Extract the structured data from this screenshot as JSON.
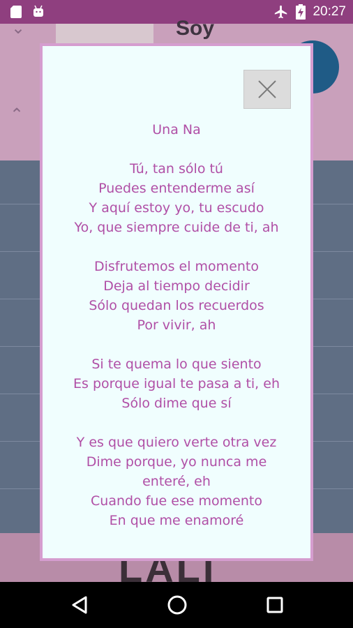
{
  "status_bar": {
    "time": "20:27",
    "icons": [
      "sd-card-icon",
      "android-icon",
      "airplane-icon",
      "battery-charging-icon"
    ]
  },
  "background_app": {
    "title_partial": "Soy",
    "footer_partial": "LALI"
  },
  "dialog": {
    "close_icon": "close-icon",
    "title": "Una Na",
    "lines": [
      "",
      "Tú, tan sólo tú",
      "Puedes entenderme así",
      "Y aquí estoy yo, tu escudo",
      "Yo, que siempre cuide de ti, ah",
      "",
      "Disfrutemos el momento",
      "Deja al tiempo decidir",
      "Sólo quedan los recuerdos",
      "Por vivir, ah",
      "",
      "Si te quema lo que siento",
      "Es porque igual te pasa a ti, eh",
      "Sólo dime que sí",
      "",
      "Y es que quiero verte otra vez",
      "Dime porque, yo nunca me",
      "enteré, eh",
      "Cuando fue ese momento",
      "En que me enamoré"
    ]
  },
  "nav_bar": {
    "buttons": [
      "back-icon",
      "home-icon",
      "recents-icon"
    ]
  }
}
